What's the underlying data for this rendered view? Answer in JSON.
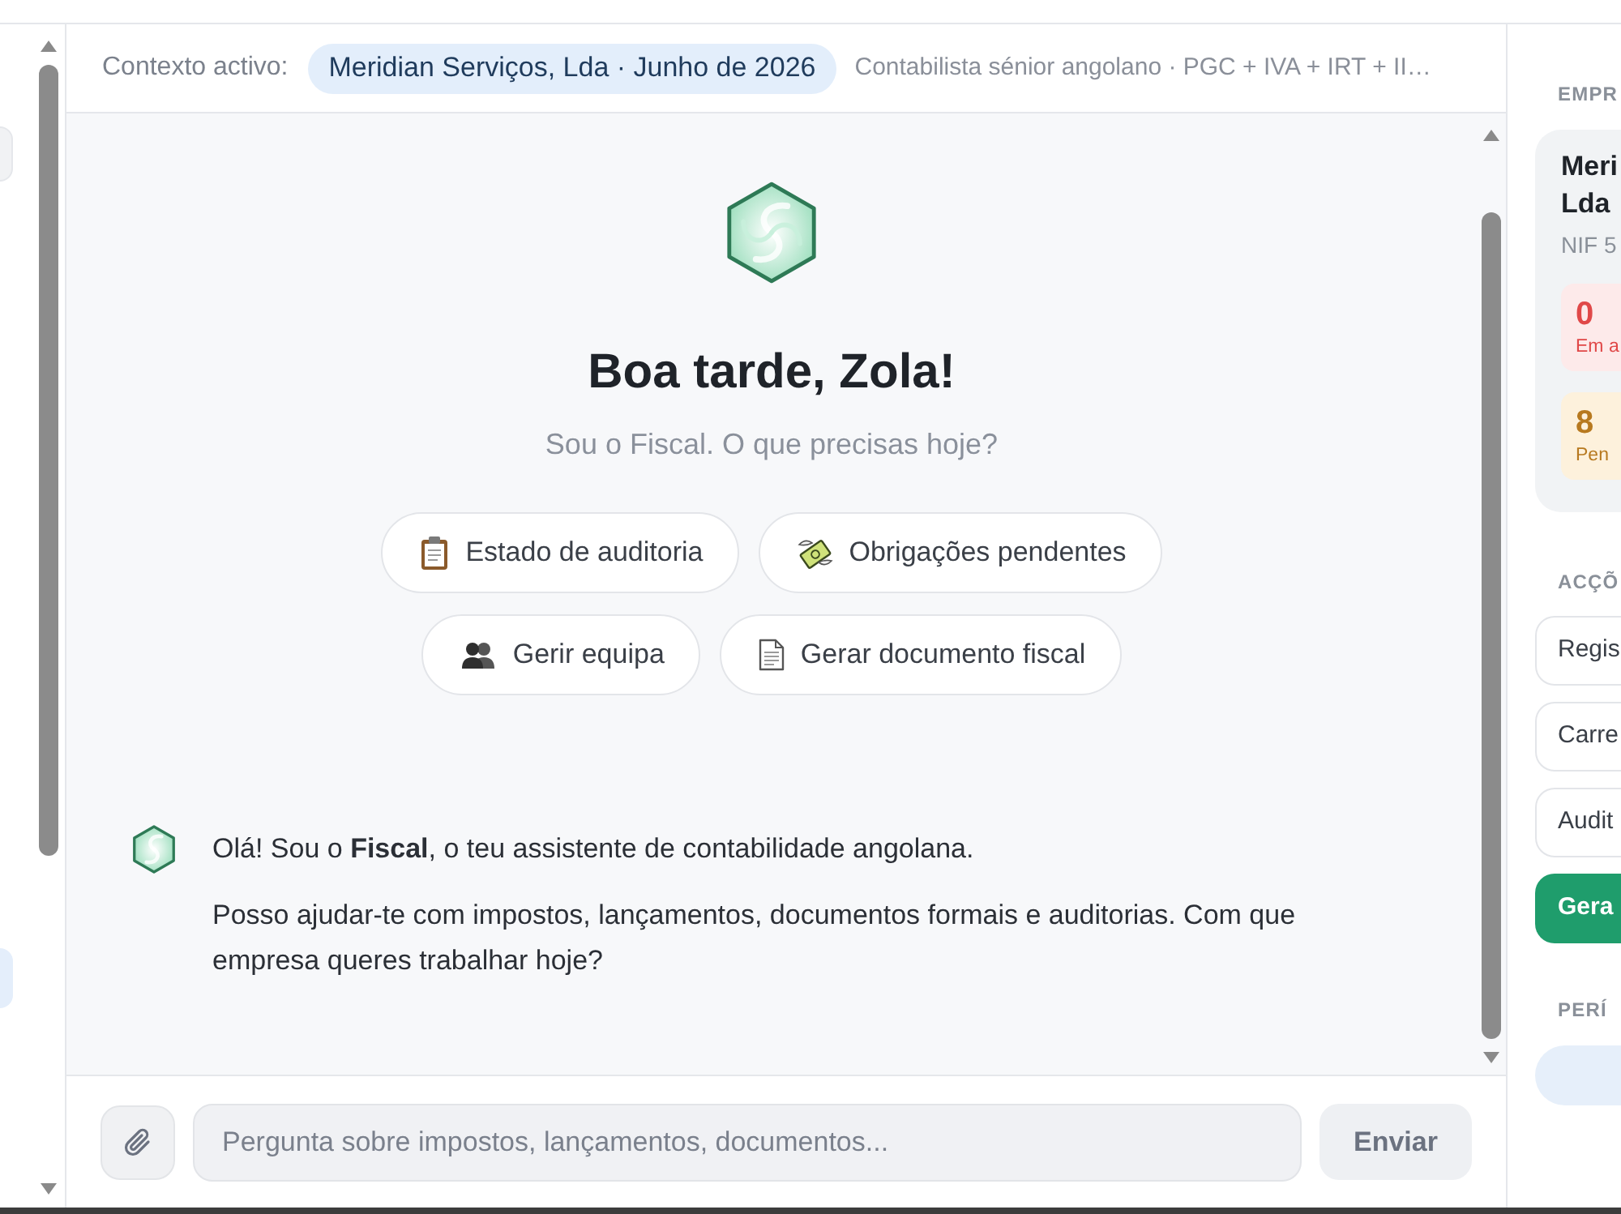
{
  "sidebar": {
    "items": [
      {
        "selected": false
      },
      {
        "selected": true
      }
    ]
  },
  "header": {
    "context_label": "Contexto activo:",
    "context_pill": "Meridian Serviços, Lda · Junho de 2026",
    "assistant_description": "Contabilista sénior angolano · PGC + IVA + IRT + II…"
  },
  "welcome": {
    "title": "Boa tarde, Zola!",
    "subtitle": "Sou o Fiscal. O que precisas hoje?",
    "suggestions": [
      {
        "label": "Estado de auditoria"
      },
      {
        "label": "Obrigações pendentes"
      },
      {
        "label": "Gerir equipa"
      },
      {
        "label": "Gerar documento fiscal"
      }
    ]
  },
  "messages": [
    {
      "kind": "assistant",
      "paragraphs": [
        "Olá! Sou o **Fiscal**, o teu assistente de contabilidade angolana.",
        "Posso ajudar-te com impostos, lançamentos, documentos formais e auditorias. Com que empresa queres trabalhar hoje?"
      ]
    }
  ],
  "composer": {
    "placeholder": "Pergunta sobre impostos, lançamentos, documentos...",
    "send_button": {
      "label": "Enviar",
      "disabled": true
    }
  },
  "right_panel": {
    "company": {
      "heading": "EMPR",
      "name_lines": [
        "Meri",
        "Lda"
      ],
      "nif": "NIF 5",
      "stats": [
        {
          "value": "0",
          "label": "Em a",
          "kind": "danger"
        },
        {
          "value": "8",
          "label": "Pen",
          "kind": "warning"
        }
      ]
    },
    "actions": {
      "heading": "ACÇÕ",
      "buttons": [
        {
          "label": "Regis",
          "kind": "outline"
        },
        {
          "label": "Carre",
          "kind": "outline"
        },
        {
          "label": "Audit",
          "kind": "outline"
        },
        {
          "label": "Gera",
          "kind": "primary"
        }
      ]
    },
    "period": {
      "heading": "PERÍ"
    }
  }
}
